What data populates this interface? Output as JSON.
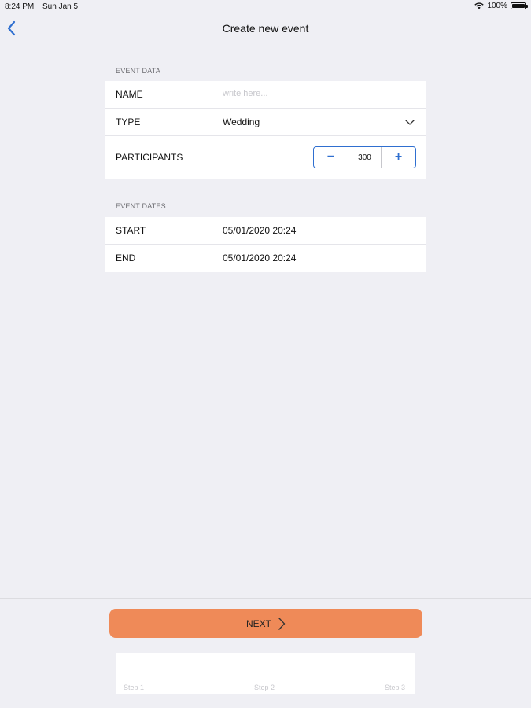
{
  "status_bar": {
    "time": "8:24 PM",
    "date": "Sun Jan 5",
    "battery": "100%"
  },
  "nav": {
    "title": "Create new event"
  },
  "event_data": {
    "header": "EVENT DATA",
    "name_label": "NAME",
    "name_placeholder": "write here...",
    "type_label": "TYPE",
    "type_value": "Wedding",
    "participants_label": "PARTICIPANTS",
    "participants_value": "300",
    "minus_label": "−",
    "plus_label": "+"
  },
  "event_dates": {
    "header": "EVENT DATES",
    "start_label": "START",
    "start_value": "05/01/2020 20:24",
    "end_label": "END",
    "end_value": "05/01/2020 20:24"
  },
  "next_button": {
    "label": "NEXT"
  },
  "progress": {
    "steps": [
      "Step 1",
      "Step 2",
      "Step 3"
    ]
  },
  "colors": {
    "accent": "#2f6fd0",
    "next_button": "#ef8a58",
    "background": "#efeff4"
  }
}
